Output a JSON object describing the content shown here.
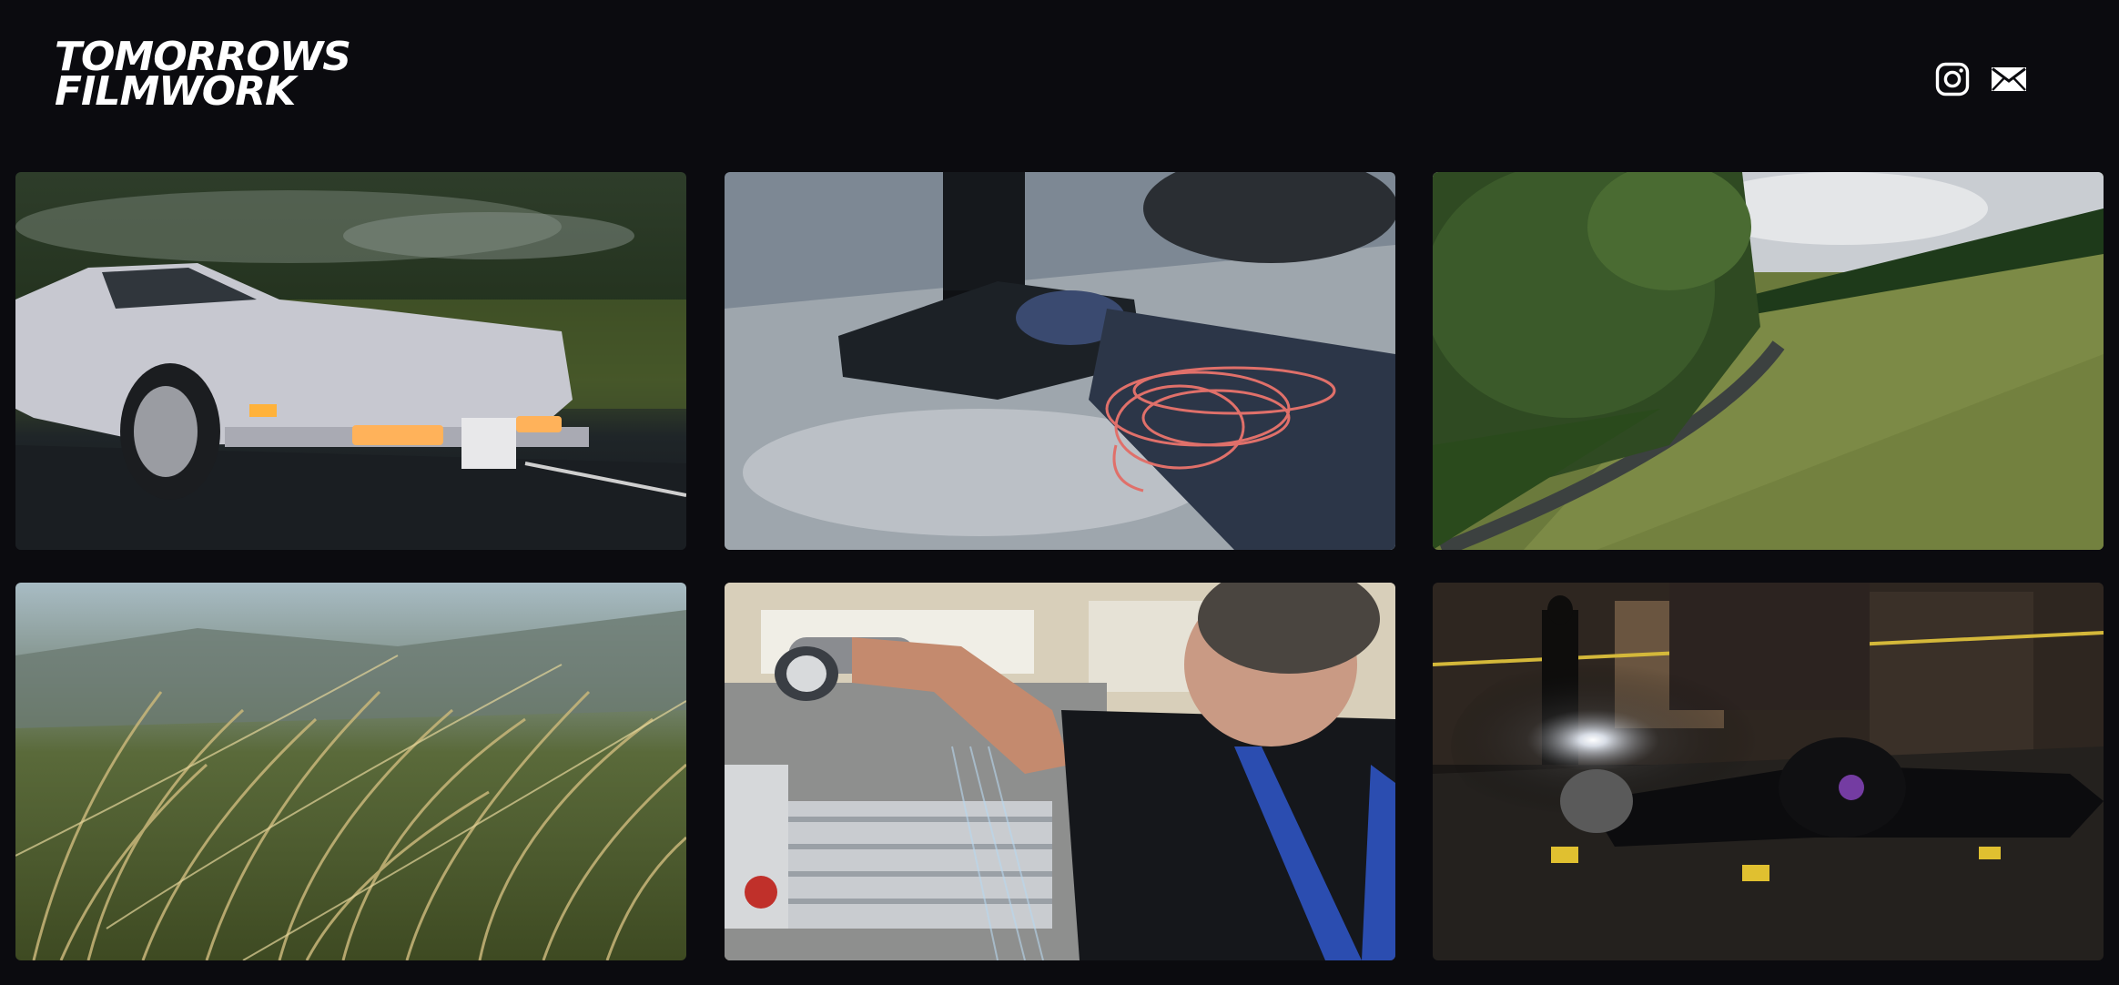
{
  "brand": {
    "line1": "TOMORROWS",
    "line2": "FILMWORK"
  },
  "header": {
    "icons": [
      "instagram-icon",
      "mail-icon"
    ]
  },
  "colors": {
    "background": "#0b0b0f",
    "text": "#ffffff"
  },
  "gallery": {
    "tiles": [
      {
        "name": "white sports car driving"
      },
      {
        "name": "climbing gear and red rope on rock"
      },
      {
        "name": "aerial view of road through fields"
      },
      {
        "name": "tall grass in wind"
      },
      {
        "name": "worker operating machine in factory"
      },
      {
        "name": "night crime scene with flashlight"
      }
    ]
  }
}
